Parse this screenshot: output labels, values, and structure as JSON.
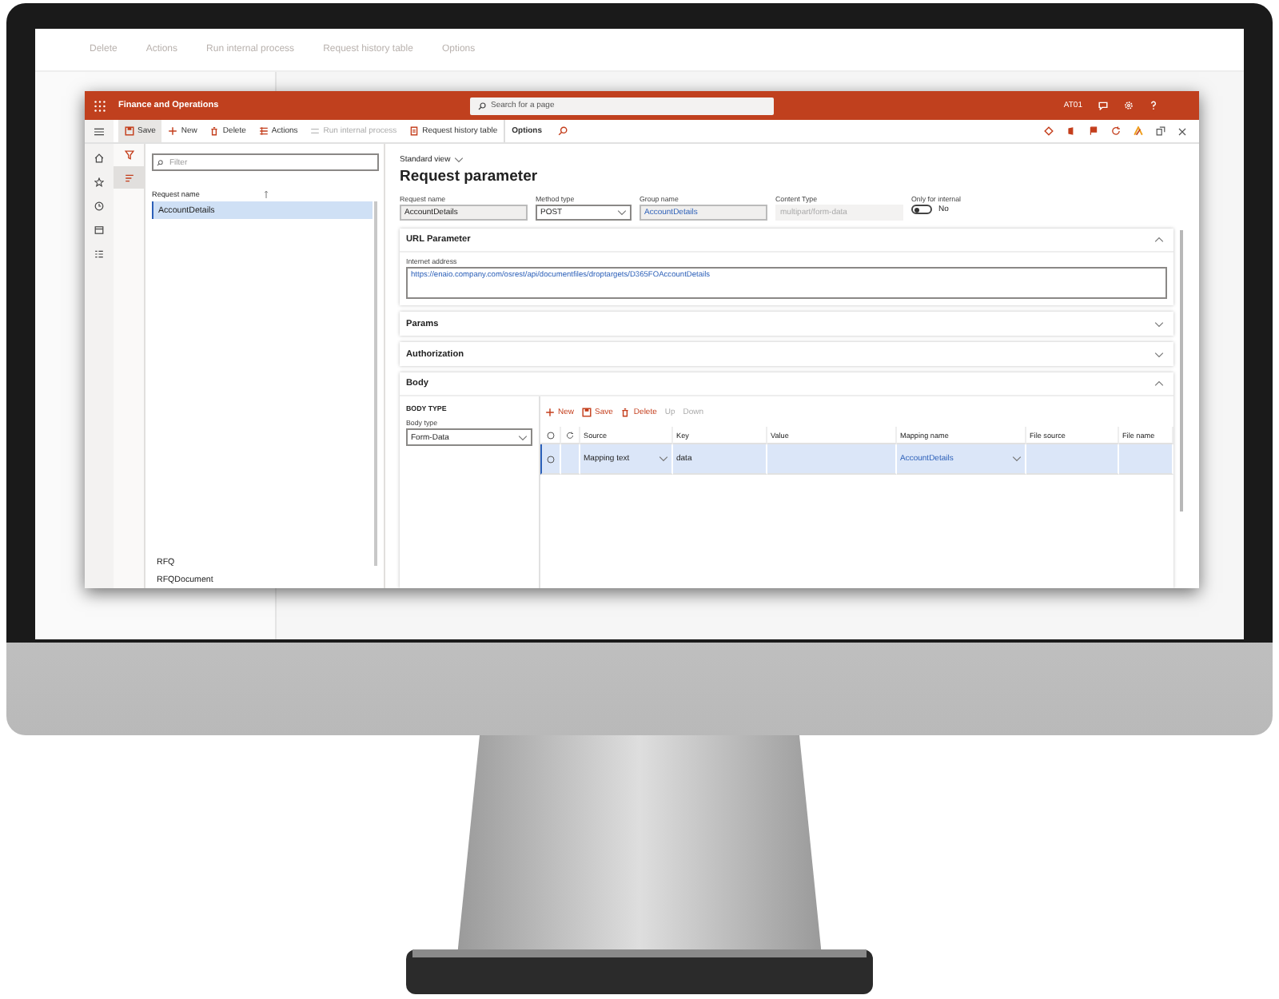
{
  "background_screen": {
    "toolbar": [
      "Delete",
      "Actions",
      "Run internal process",
      "Request history table",
      "Options"
    ]
  },
  "window": {
    "title": "Finance and Operations",
    "search": {
      "placeholder": "Search for a page"
    },
    "company": "AT01"
  },
  "toolbar": [
    {
      "label": "Save",
      "kind": "save",
      "disabled": false,
      "selected": true
    },
    {
      "label": "New",
      "kind": "new",
      "disabled": false,
      "selected": false
    },
    {
      "label": "Delete",
      "kind": "delete",
      "disabled": false,
      "selected": false
    },
    {
      "label": "Actions",
      "kind": "actions",
      "disabled": false,
      "selected": false
    },
    {
      "label": "Run internal process",
      "kind": "run",
      "disabled": true,
      "selected": false
    },
    {
      "label": "Request history table",
      "kind": "history",
      "disabled": false,
      "selected": false
    },
    {
      "label": "Options",
      "kind": "tab",
      "disabled": false,
      "selected": false
    }
  ],
  "list_pane": {
    "filter": {
      "placeholder": "Filter"
    },
    "column": "Request name",
    "items": [
      {
        "label": "AccountDetails",
        "selected": true
      },
      {
        "label": "RFQ",
        "selected": false
      },
      {
        "label": "RFQDocument",
        "selected": false
      }
    ]
  },
  "form": {
    "view": "Standard view",
    "title": "Request parameter",
    "fields": [
      {
        "label": "Request name",
        "value": "AccountDetails",
        "kind": "text",
        "readonly": true,
        "disabled": false
      },
      {
        "label": "Method type",
        "value": "POST",
        "kind": "select",
        "readonly": false,
        "disabled": false
      },
      {
        "label": "Group name",
        "value": "AccountDetails",
        "kind": "link",
        "readonly": true,
        "disabled": false
      },
      {
        "label": "Content Type",
        "value": "multipart/form-data",
        "kind": "text",
        "readonly": true,
        "disabled": true
      }
    ],
    "toggle": {
      "label": "Only for internal",
      "on": false,
      "value": "No"
    },
    "sections": [
      {
        "title": "URL Parameter",
        "expanded": true,
        "kind": "url",
        "field": {
          "label": "Internet address",
          "value": "https://enaio.company.com/osrest/api/documentfiles/droptargets/D365FOAccountDetails"
        }
      },
      {
        "title": "Params",
        "expanded": false
      },
      {
        "title": "Authorization",
        "expanded": false
      },
      {
        "title": "Body",
        "expanded": true,
        "kind": "body",
        "heading": "BODY TYPE",
        "body_type": {
          "label": "Body type",
          "value": "Form-Data"
        },
        "grid_toolbar": [
          {
            "label": "New",
            "kind": "new",
            "disabled": false
          },
          {
            "label": "Save",
            "kind": "save",
            "disabled": false
          },
          {
            "label": "Delete",
            "kind": "delete",
            "disabled": false
          },
          {
            "label": "Up",
            "kind": "up",
            "disabled": true
          },
          {
            "label": "Down",
            "kind": "down",
            "disabled": true
          }
        ],
        "columns": [
          "Source",
          "Key",
          "Value",
          "Mapping name",
          "File source",
          "File name"
        ],
        "rows": [
          {
            "selected": true,
            "cells": [
              {
                "kind": "select",
                "text": "Mapping text"
              },
              {
                "kind": "text",
                "text": "data"
              },
              {
                "kind": "empty"
              },
              {
                "kind": "link-select",
                "text": "AccountDetails"
              },
              {
                "kind": "empty"
              },
              {
                "kind": "empty"
              }
            ]
          }
        ]
      }
    ]
  }
}
